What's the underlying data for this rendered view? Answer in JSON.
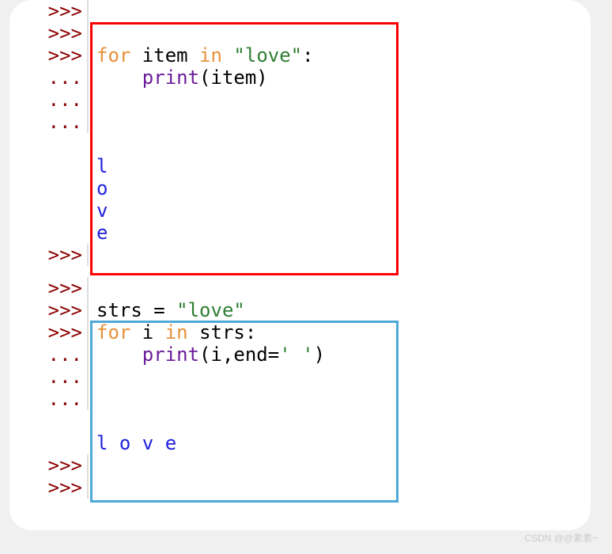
{
  "prompts": {
    "primary": ">>>",
    "secondary": "..."
  },
  "block1": {
    "for_kw": "for",
    "item_var": " item ",
    "in_kw": "in",
    "string_literal": " \"love\"",
    "colon": ":",
    "indent": "    ",
    "print_func": "print",
    "lparen": "(",
    "print_arg": "item",
    "rparen": ")",
    "output": [
      "l",
      "o",
      "v",
      "e"
    ]
  },
  "block2": {
    "assign_var": "strs ",
    "eq": "= ",
    "assign_val": "\"love\"",
    "for_kw": "for",
    "i_var": " i ",
    "in_kw": "in",
    "strs_ref": " strs",
    "colon": ":",
    "indent": "    ",
    "print_func": "print",
    "lparen": "(",
    "arg_i": "i",
    "comma": ",",
    "kwarg": "end",
    "eq2": "=",
    "endval": "' '",
    "rparen": ")",
    "output": "l o v e "
  },
  "watermark": "CSDN @@素素~"
}
